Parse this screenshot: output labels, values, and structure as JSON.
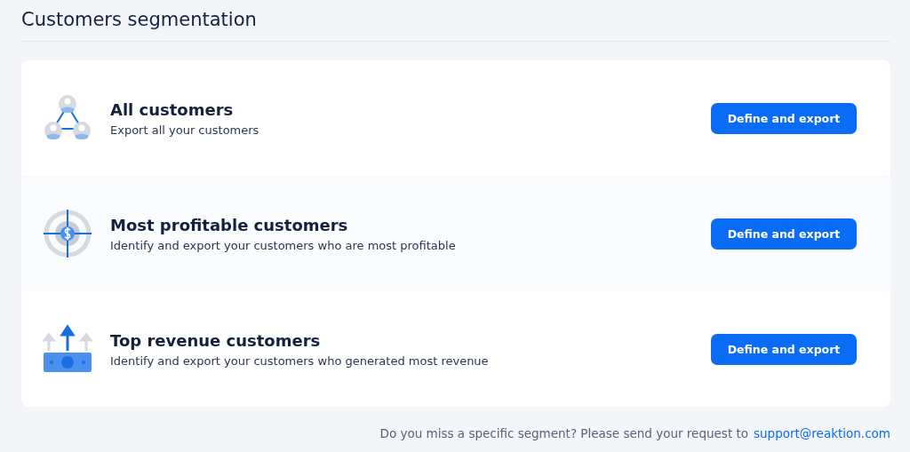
{
  "title": "Customers segmentation",
  "segments": [
    {
      "kind": "network",
      "name": "All customers",
      "description": "Export all your customers",
      "button": "Define and export"
    },
    {
      "kind": "target",
      "name": "Most profitable customers",
      "description": "Identify and export your customers who are most profitable",
      "button": "Define and export"
    },
    {
      "kind": "money",
      "name": "Top revenue customers",
      "description": "Identify and export your customers who generated most revenue",
      "button": "Define and export"
    }
  ],
  "footer": {
    "text": "Do you miss a specific segment? Please send your request to",
    "link": "support@reaktion.com"
  }
}
